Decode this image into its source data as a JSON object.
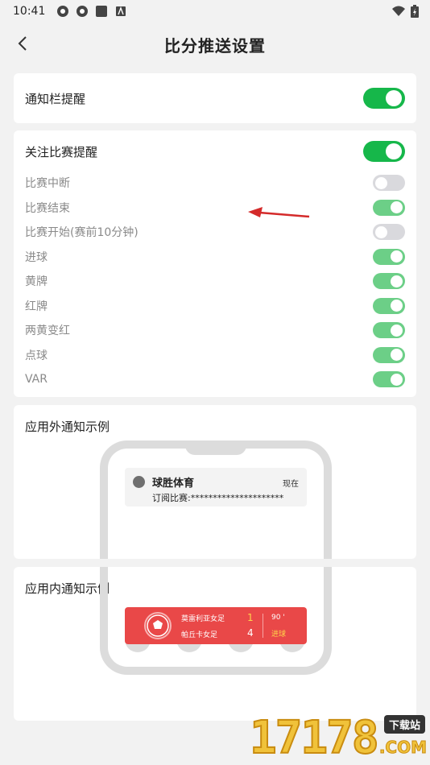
{
  "status_bar": {
    "time": "10:41"
  },
  "header": {
    "title": "比分推送设置"
  },
  "notification_bar": {
    "label": "通知栏提醒",
    "enabled": true
  },
  "follow_match": {
    "label": "关注比赛提醒",
    "enabled": true,
    "items": [
      {
        "label": "比赛中断",
        "enabled": false
      },
      {
        "label": "比赛结束",
        "enabled": true
      },
      {
        "label": "比赛开始(赛前10分钟)",
        "enabled": false
      },
      {
        "label": "进球",
        "enabled": true
      },
      {
        "label": "黄牌",
        "enabled": true
      },
      {
        "label": "红牌",
        "enabled": true
      },
      {
        "label": "两黄变红",
        "enabled": true
      },
      {
        "label": "点球",
        "enabled": true
      },
      {
        "label": "VAR",
        "enabled": true
      }
    ]
  },
  "outside_example": {
    "title": "应用外通知示例",
    "app_name": "球胜体育",
    "time": "现在",
    "body": "订阅比赛:*********************"
  },
  "inside_example": {
    "title": "应用内通知示例",
    "home_team": "莫雷利亚女足",
    "away_team": "帕丘卡女足",
    "home_score": "1",
    "away_score": "4",
    "minute": "90 '",
    "event": "进球"
  },
  "watermark": {
    "digits": "17178",
    "tag": "下载站",
    "domain": ".COM"
  },
  "colors": {
    "toggle_on": "#16b74a",
    "toggle_on_light": "#6ccf87",
    "toggle_off": "#d9d9dd",
    "toast_red": "#e94848",
    "arrow_red": "#d42a2a"
  }
}
